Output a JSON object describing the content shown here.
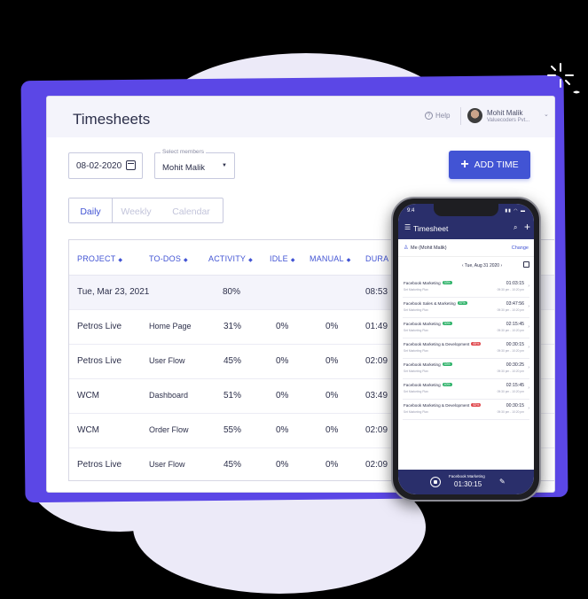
{
  "header": {
    "title": "Timesheets",
    "help_label": "Help",
    "help_icon": "?",
    "user_name": "Mohit Malik",
    "user_org": "Valuecoders Pvt..."
  },
  "filters": {
    "date_value": "08-02-2020",
    "members_label": "Select members",
    "members_value": "Mohit Malik"
  },
  "actions": {
    "add_time_label": "ADD TIME"
  },
  "tabs": [
    {
      "label": "Daily"
    },
    {
      "label": "Weekly"
    },
    {
      "label": "Calendar"
    }
  ],
  "table": {
    "columns": [
      "PROJECT",
      "TO-DOS",
      "ACTIVITY",
      "IDLE",
      "MANUAL",
      "DURA"
    ],
    "summary": {
      "date": "Tue, Mar 23, 2021",
      "activity": "80%",
      "duration": "08:53"
    },
    "rows": [
      {
        "project": "Petros Live",
        "todo": "Home Page",
        "activity": "31%",
        "idle": "0%",
        "manual": "0%",
        "duration": "01:49"
      },
      {
        "project": "Petros Live",
        "todo": "User Flow",
        "activity": "45%",
        "idle": "0%",
        "manual": "0%",
        "duration": "02:09"
      },
      {
        "project": "WCM",
        "todo": "Dashboard",
        "activity": "51%",
        "idle": "0%",
        "manual": "0%",
        "duration": "03:49"
      },
      {
        "project": "WCM",
        "todo": "Order Flow",
        "activity": "55%",
        "idle": "0%",
        "manual": "0%",
        "duration": "02:09"
      },
      {
        "project": "Petros Live",
        "todo": "User Flow",
        "activity": "45%",
        "idle": "0%",
        "manual": "0%",
        "duration": "02:09"
      }
    ]
  },
  "phone": {
    "status_time": "9:4",
    "title": "Timesheet",
    "filter_user": "Me (Mohit Malik)",
    "change_label": "Change",
    "date": "Tue, Aug 31 2020",
    "entries": [
      {
        "name": "Facebook Marketing",
        "badge": "33%",
        "badge_color": "#2fb36a",
        "sub": "Set Marketing Plan",
        "duration": "01:03:15",
        "range": "09:30 pm - 10:20 pm"
      },
      {
        "name": "Facebook Sales & Marketing",
        "badge": "57%",
        "badge_color": "#2fb36a",
        "sub": "Set Marketing Plan",
        "duration": "03:47:56",
        "range": "09:30 pm - 10:20 pm"
      },
      {
        "name": "Facebook Marketing",
        "badge": "30%",
        "badge_color": "#2fb36a",
        "sub": "Set Marketing Plan",
        "duration": "02:15:45",
        "range": "09:30 pm - 10:20 pm"
      },
      {
        "name": "Facebook Marketing & Development",
        "badge": "65%",
        "badge_color": "#e0474c",
        "sub": "Set Marketing Plan",
        "duration": "00:30:15",
        "range": "09:30 pm - 10:20 pm"
      },
      {
        "name": "Facebook Marketing",
        "badge": "33%",
        "badge_color": "#2fb36a",
        "sub": "Set Marketing Plan",
        "duration": "00:30:25",
        "range": "09:30 pm - 10:20 pm"
      },
      {
        "name": "Facebook Marketing",
        "badge": "40%",
        "badge_color": "#2fb36a",
        "sub": "Set Marketing Plan",
        "duration": "02:15:45",
        "range": "09:30 pm - 10:20 pm"
      },
      {
        "name": "Facebook Marketing & Development",
        "badge": "52%",
        "badge_color": "#e0474c",
        "sub": "Set Marketing Plan",
        "duration": "00:30:15",
        "range": "09:30 pm - 10:20 pm"
      }
    ],
    "current_project": "Facebook Marketing",
    "current_timer": "01:30:15"
  }
}
